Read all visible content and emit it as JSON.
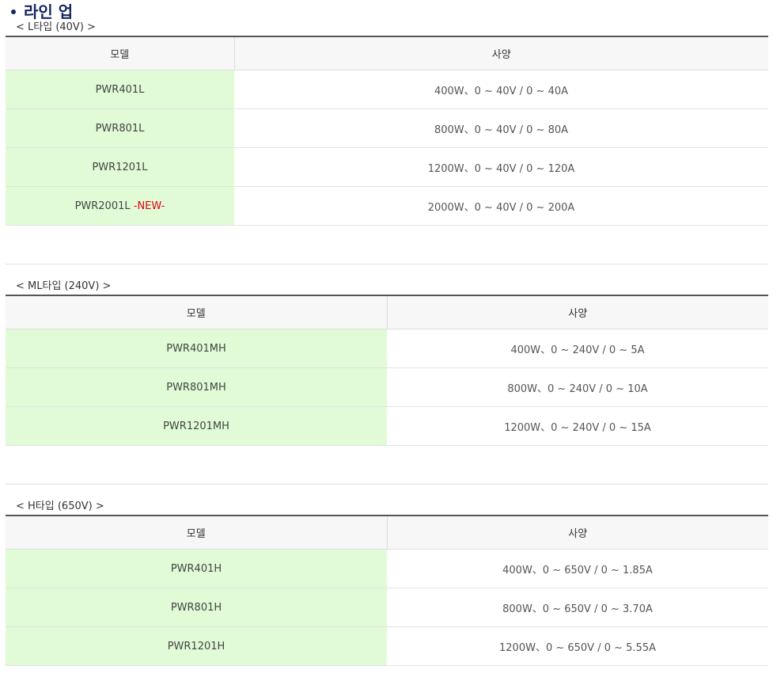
{
  "page": {
    "title": "라인 업"
  },
  "sections": [
    {
      "label": "< L타입 (40V) >",
      "headers": {
        "model": "모델",
        "spec": "사양"
      },
      "rows": [
        {
          "model": "PWR401L",
          "spec": "400W、0 ~ 40V / 0 ~ 40A"
        },
        {
          "model": "PWR801L",
          "spec": "800W、0 ~ 40V / 0 ~ 80A"
        },
        {
          "model": "PWR1201L",
          "spec": "1200W、0 ~ 40V / 0 ~ 120A"
        },
        {
          "model": "PWR2001L",
          "badge": "-NEW-",
          "spec": "2000W、0 ~ 40V / 0 ~ 200A"
        }
      ]
    },
    {
      "label": "< ML타입 (240V) >",
      "headers": {
        "model": "모델",
        "spec": "사양"
      },
      "rows": [
        {
          "model": "PWR401MH",
          "spec": "400W、0 ~ 240V / 0 ~ 5A"
        },
        {
          "model": "PWR801MH",
          "spec": "800W、0 ~ 240V / 0 ~ 10A"
        },
        {
          "model": "PWR1201MH",
          "spec": "1200W、0 ~ 240V / 0 ~ 15A"
        }
      ]
    },
    {
      "label": "< H타입 (650V) >",
      "headers": {
        "model": "모델",
        "spec": "사양"
      },
      "rows": [
        {
          "model": "PWR401H",
          "spec": "400W、0 ~ 650V / 0 ~ 1.85A"
        },
        {
          "model": "PWR801H",
          "spec": "800W、0 ~ 650V / 0 ~ 3.70A"
        },
        {
          "model": "PWR1201H",
          "spec": "1200W、0 ~ 650V / 0 ~ 5.55A"
        }
      ]
    }
  ]
}
